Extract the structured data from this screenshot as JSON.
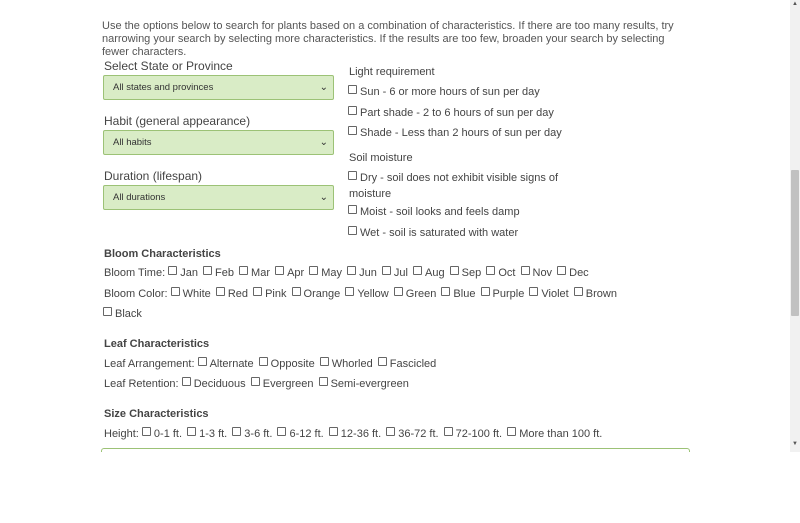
{
  "intro": "Use the options below to search for plants based on a combination of characteristics. If there are too many results, try narrowing your search by selecting more characteristics. If the results are too few, broaden your search by selecting fewer characters.",
  "filters": {
    "state": {
      "label": "Select State or Province",
      "value": "All states and provinces"
    },
    "habit": {
      "label": "Habit (general appearance)",
      "value": "All habits"
    },
    "duration": {
      "label": "Duration (lifespan)",
      "value": "All durations"
    }
  },
  "light": {
    "label": "Light requirement",
    "options": [
      "Sun - 6 or more hours of sun per day",
      "Part shade - 2 to 6 hours of sun per day",
      "Shade - Less than 2 hours of sun per day"
    ]
  },
  "soil": {
    "label": "Soil moisture",
    "options": [
      "Dry - soil does not exhibit visible signs of",
      "moisture",
      "Moist - soil looks and feels damp",
      "Wet - soil is saturated with water"
    ]
  },
  "bloom": {
    "heading": "Bloom Characteristics",
    "time_label": "Bloom Time:",
    "months": [
      "Jan",
      "Feb",
      "Mar",
      "Apr",
      "May",
      "Jun",
      "Jul",
      "Aug",
      "Sep",
      "Oct",
      "Nov",
      "Dec"
    ],
    "color_label": "Bloom Color:",
    "colors": [
      "White",
      "Red",
      "Pink",
      "Orange",
      "Yellow",
      "Green",
      "Blue",
      "Purple",
      "Violet",
      "Brown",
      "Black"
    ]
  },
  "leaf": {
    "heading": "Leaf Characteristics",
    "arrangement_label": "Leaf Arrangement:",
    "arrangements": [
      "Alternate",
      "Opposite",
      "Whorled",
      "Fascicled"
    ],
    "retention_label": "Leaf Retention:",
    "retentions": [
      "Deciduous",
      "Evergreen",
      "Semi-evergreen"
    ]
  },
  "size": {
    "heading": "Size Characteristics",
    "height_label": "Height:",
    "heights": [
      "0-1 ft.",
      "1-3 ft.",
      "3-6 ft.",
      "6-12 ft.",
      "12-36 ft.",
      "36-72 ft.",
      "72-100 ft.",
      "More than 100 ft."
    ]
  },
  "scrollbar": {
    "up": "▲",
    "down": "▼"
  },
  "icons": {
    "chevron": "⌄"
  }
}
